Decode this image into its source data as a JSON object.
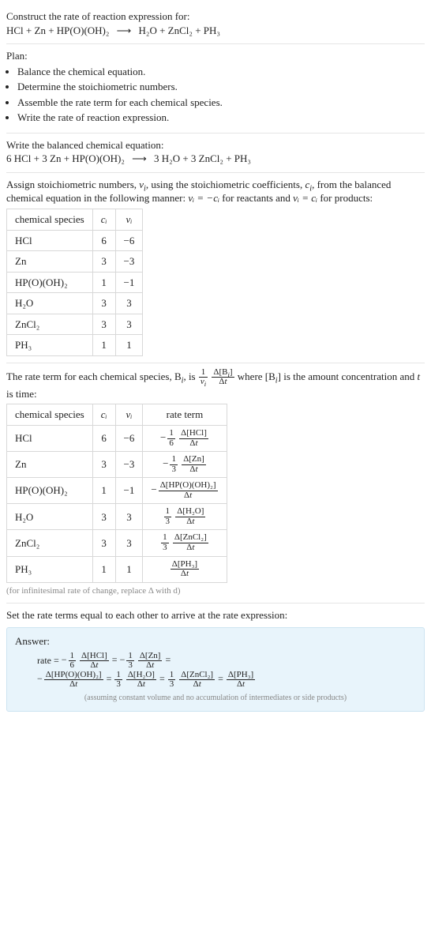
{
  "prompt": {
    "title": "Construct the rate of reaction expression for:",
    "lhs": "HCl + Zn + HP(O)(OH)₂",
    "rhs": "H₂O + ZnCl₂ + PH₃"
  },
  "plan": {
    "title": "Plan:",
    "items": [
      "Balance the chemical equation.",
      "Determine the stoichiometric numbers.",
      "Assemble the rate term for each chemical species.",
      "Write the rate of reaction expression."
    ]
  },
  "balanced": {
    "title": "Write the balanced chemical equation:",
    "lhs": "6 HCl + 3 Zn + HP(O)(OH)₂",
    "rhs": "3 H₂O + 3 ZnCl₂ + PH₃"
  },
  "assign": {
    "text_a": "Assign stoichiometric numbers, ",
    "nu_i": "ν",
    "text_b": ", using the stoichiometric coefficients, ",
    "c_i": "c",
    "text_c": ", from the balanced chemical equation in the following manner: ",
    "rel_react": "νᵢ = −cᵢ",
    "text_d": " for reactants and ",
    "rel_prod": "νᵢ = cᵢ",
    "text_e": " for products:"
  },
  "table1": {
    "headers": [
      "chemical species",
      "cᵢ",
      "νᵢ"
    ],
    "rows": [
      {
        "sp": "HCl",
        "c": "6",
        "nu": "−6"
      },
      {
        "sp": "Zn",
        "c": "3",
        "nu": "−3"
      },
      {
        "sp": "HP(O)(OH)₂",
        "c": "1",
        "nu": "−1"
      },
      {
        "sp": "H₂O",
        "c": "3",
        "nu": "3"
      },
      {
        "sp": "ZnCl₂",
        "c": "3",
        "nu": "3"
      },
      {
        "sp": "PH₃",
        "c": "1",
        "nu": "1"
      }
    ]
  },
  "rateterm_intro": {
    "a": "The rate term for each chemical species, B",
    "b": ", is ",
    "c": " where [B",
    "d": "] is the amount concentration and ",
    "e": " is time:"
  },
  "table2": {
    "headers": [
      "chemical species",
      "cᵢ",
      "νᵢ",
      "rate term"
    ],
    "rows": [
      {
        "sp": "HCl",
        "c": "6",
        "nu": "−6",
        "sign": "−",
        "coef_num": "1",
        "coef_den": "6",
        "dnum": "Δ[HCl]",
        "dden": "Δt"
      },
      {
        "sp": "Zn",
        "c": "3",
        "nu": "−3",
        "sign": "−",
        "coef_num": "1",
        "coef_den": "3",
        "dnum": "Δ[Zn]",
        "dden": "Δt"
      },
      {
        "sp": "HP(O)(OH)₂",
        "c": "1",
        "nu": "−1",
        "sign": "−",
        "coef_num": "",
        "coef_den": "",
        "dnum": "Δ[HP(O)(OH)₂]",
        "dden": "Δt"
      },
      {
        "sp": "H₂O",
        "c": "3",
        "nu": "3",
        "sign": "",
        "coef_num": "1",
        "coef_den": "3",
        "dnum": "Δ[H₂O]",
        "dden": "Δt"
      },
      {
        "sp": "ZnCl₂",
        "c": "3",
        "nu": "3",
        "sign": "",
        "coef_num": "1",
        "coef_den": "3",
        "dnum": "Δ[ZnCl₂]",
        "dden": "Δt"
      },
      {
        "sp": "PH₃",
        "c": "1",
        "nu": "1",
        "sign": "",
        "coef_num": "",
        "coef_den": "",
        "dnum": "Δ[PH₃]",
        "dden": "Δt"
      }
    ],
    "caption": "(for infinitesimal rate of change, replace Δ with d)"
  },
  "setequal": "Set the rate terms equal to each other to arrive at the rate expression:",
  "answer": {
    "label": "Answer:",
    "note": "(assuming constant volume and no accumulation of intermediates or side products)",
    "lead": "rate = ",
    "terms": [
      {
        "sign": "−",
        "coef_num": "1",
        "coef_den": "6",
        "dnum": "Δ[HCl]",
        "dden": "Δt"
      },
      {
        "sign": "−",
        "coef_num": "1",
        "coef_den": "3",
        "dnum": "Δ[Zn]",
        "dden": "Δt"
      },
      {
        "sign": "−",
        "coef_num": "",
        "coef_den": "",
        "dnum": "Δ[HP(O)(OH)₂]",
        "dden": "Δt"
      },
      {
        "sign": "",
        "coef_num": "1",
        "coef_den": "3",
        "dnum": "Δ[H₂O]",
        "dden": "Δt"
      },
      {
        "sign": "",
        "coef_num": "1",
        "coef_den": "3",
        "dnum": "Δ[ZnCl₂]",
        "dden": "Δt"
      },
      {
        "sign": "",
        "coef_num": "",
        "coef_den": "",
        "dnum": "Δ[PH₃]",
        "dden": "Δt"
      }
    ]
  },
  "sym": {
    "i": "i",
    "t": "t",
    "eq": " = "
  }
}
